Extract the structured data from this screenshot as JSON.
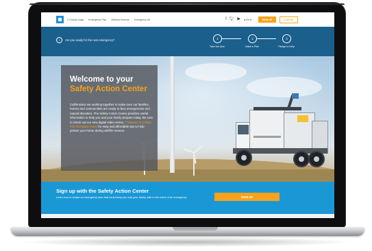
{
  "nav": {
    "links": [
      "2 Tubular Days",
      "Emergency Plan",
      "Medical Devices",
      "Emergency Kit"
    ],
    "social_icons": [
      "f",
      "t",
      "yt",
      "email"
    ],
    "language": "En",
    "signup_label": "SIGN UP",
    "login_label": "LOG IN"
  },
  "readiness": {
    "question": "Are you ready for the next emergency?",
    "steps": [
      {
        "number": "1",
        "label": "Take the Quiz"
      },
      {
        "number": "2",
        "label": "Make a Plan"
      },
      {
        "number": "3",
        "label": "Pledge to Help"
      }
    ]
  },
  "hero": {
    "title_line1": "Welcome to your",
    "title_line2": "Safety Action Center",
    "body_part1": "Californians are working together to make sure our families, homes and communities are ready to face emergencies and natural disasters. The Safety Action Center provides useful information to help you and your family prepare today. Be sure to check out our new digital video series, ",
    "body_link": "7 Minutes to a More Fire Resistant Home",
    "body_part2": " for easy and affordable tips to help protect your home during wildfire season."
  },
  "signup": {
    "title": "Sign up with the Safety Action Center",
    "description": "Learn how to create an emergency plan that could keep you and your family safe in the event of an emergency",
    "button_label": "SIGN UP"
  },
  "colors": {
    "accent": "#f7a21b",
    "ready_bar": "#1b5f8c",
    "signup_band": "#1a98d5",
    "logo": "#1e8fd6"
  }
}
